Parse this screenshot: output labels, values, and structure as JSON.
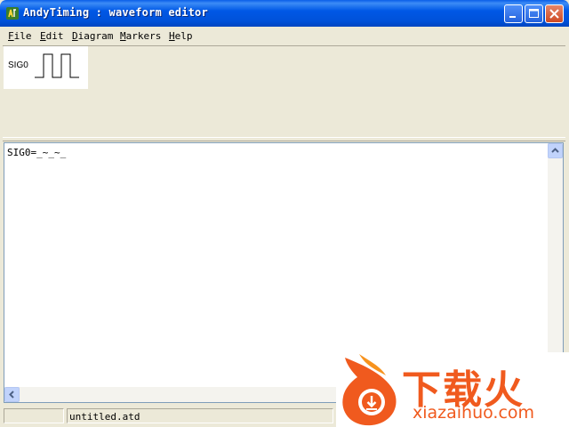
{
  "window": {
    "title": "AndyTiming : waveform editor",
    "controls": [
      "minimize",
      "maximize",
      "close"
    ]
  },
  "menu": [
    {
      "label": "File",
      "mnemonic": "F"
    },
    {
      "label": "Edit",
      "mnemonic": "E"
    },
    {
      "label": "Diagram",
      "mnemonic": "D"
    },
    {
      "label": "Markers",
      "mnemonic": "M"
    },
    {
      "label": "Help",
      "mnemonic": "H"
    }
  ],
  "waveform": {
    "signals": [
      {
        "name": "SIG0",
        "pattern": "_~_~_"
      }
    ]
  },
  "editor": {
    "text": "SIG0=_~_~_"
  },
  "status": {
    "left": "",
    "filename": "untitled.atd"
  },
  "watermark": {
    "text": "下载火",
    "url": "xiazaihuo.com"
  },
  "colors": {
    "titlebar": "#0058e6",
    "window_bg": "#ece9d8",
    "watermark": "#f05a1e"
  }
}
